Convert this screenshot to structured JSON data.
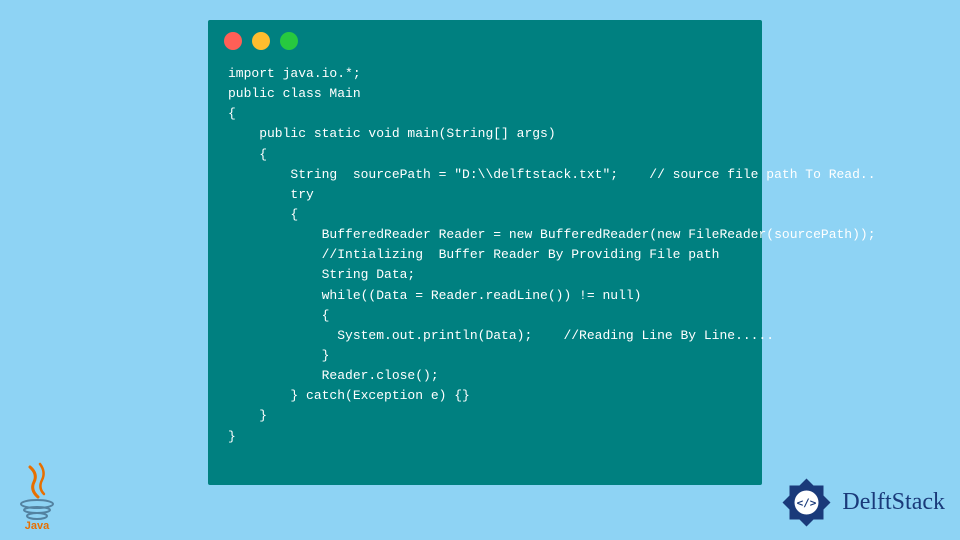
{
  "code": {
    "line1": "import java.io.*;",
    "line2": "public class Main",
    "line3": "{",
    "line4": "    public static void main(String[] args)",
    "line5": "    {",
    "line6": "        String  sourcePath = \"D:\\\\delftstack.txt\";    // source file path To Read..",
    "line7": "        try",
    "line8": "        {",
    "line9": "            BufferedReader Reader = new BufferedReader(new FileReader(sourcePath));",
    "line10": "            //Intializing  Buffer Reader By Providing File path",
    "line11": "            String Data;",
    "line12": "            while((Data = Reader.readLine()) != null)",
    "line13": "            {",
    "line14": "              System.out.println(Data);    //Reading Line By Line.....",
    "line15": "            }",
    "line16": "            Reader.close();",
    "line17": "        } catch(Exception e) {}",
    "line18": "    }",
    "line19": "}"
  },
  "logos": {
    "java_label": "Java",
    "delft_label": "DelftStack"
  }
}
